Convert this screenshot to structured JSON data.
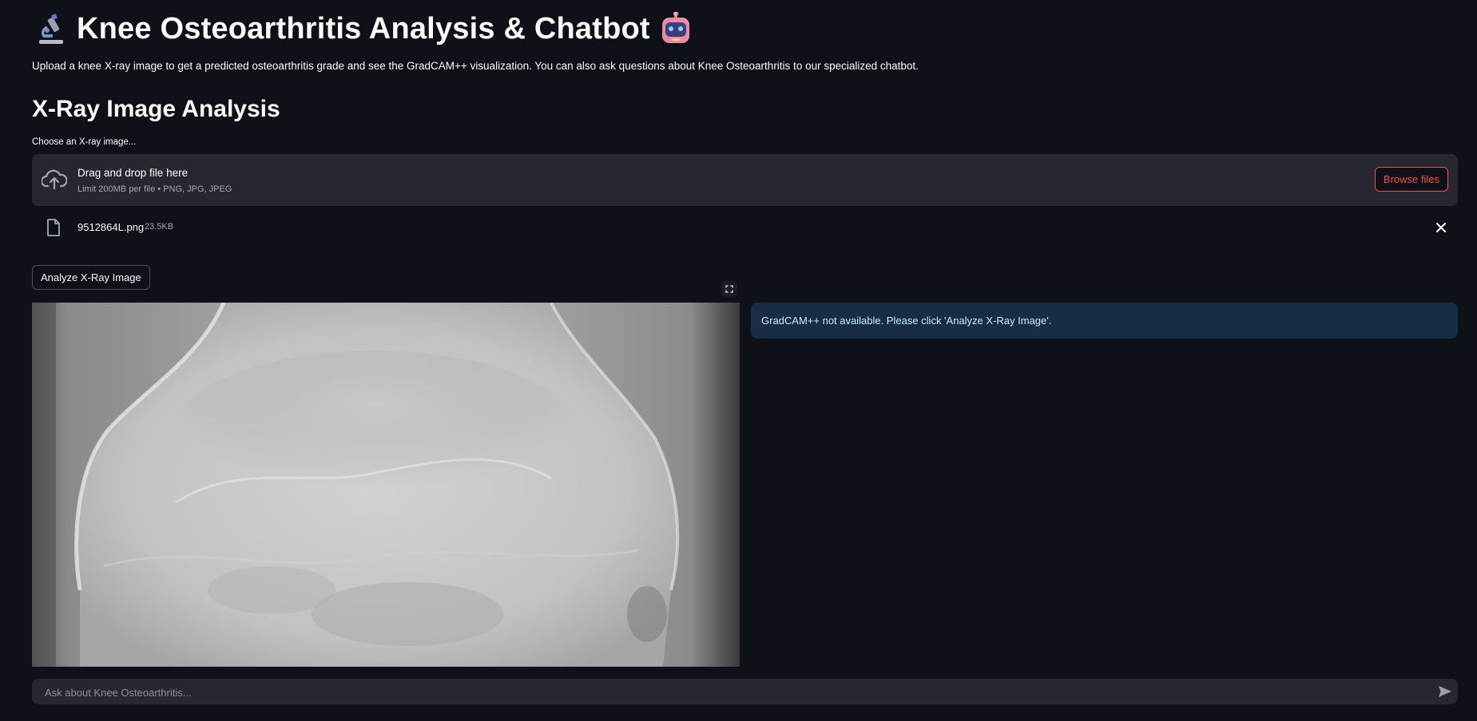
{
  "header": {
    "title": "Knee Osteoarthritis Analysis & Chatbot",
    "title_icon_left": "microscope-icon",
    "title_icon_right": "robot-icon",
    "subtitle": "Upload a knee X-ray image to get a predicted osteoarthritis grade and see the GradCAM++ visualization. You can also ask questions about Knee Osteoarthritis to our specialized chatbot."
  },
  "analysis": {
    "heading": "X-Ray Image Analysis",
    "uploader": {
      "label": "Choose an X-ray image...",
      "drop_text": "Drag and drop file here",
      "limit_text": "Limit 200MB per file • PNG, JPG, JPEG",
      "browse_label": "Browse files",
      "icon": "cloud-upload-icon"
    },
    "uploaded_file": {
      "name": "9512864L.png",
      "size": "23.5KB",
      "icon": "file-icon",
      "remove_icon": "close-icon"
    },
    "analyze_button": "Analyze X-Ray Image",
    "gradcam_message": "GradCAM++ not available. Please click 'Analyze X-Ray Image'."
  },
  "chat": {
    "placeholder": "Ask about Knee Osteoarthritis...",
    "send_icon": "send-icon"
  },
  "colors": {
    "background": "#0e1117",
    "surface": "#262730",
    "accent": "#ff4b4b",
    "info_bg": "#172d43",
    "info_text": "#c7ebff"
  }
}
